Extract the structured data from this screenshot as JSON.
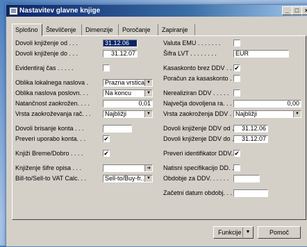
{
  "window": {
    "title": "Nastavitev glavne knjige",
    "minimize": "_",
    "restore": "□",
    "close": "×"
  },
  "tabs": [
    "Splošno",
    "Številčenje",
    "Dimenzije",
    "Poročanje",
    "Zapiranje"
  ],
  "left": {
    "allow_from_label": "Dovoli knjiženje od . . .",
    "allow_from_value": "31.12.06",
    "allow_to_label": "Dovoli knjiženje do . . .",
    "allow_to_value": "31.12.07",
    "register_time_label": "Evidentiraj čas . . . . .",
    "local_address_label": "Oblika lokalnega naslova .",
    "local_address_value": "Prazna vrstica...",
    "business_address_label": "Oblika naslova poslovn. . .",
    "business_address_value": "Na koncu",
    "rounding_precision_label": "Natančnost zaokrožen. . . .",
    "rounding_precision_value": "0,01",
    "rounding_type_label": "Vrsta zaokroževanja rač. . .",
    "rounding_type_value": "Najbližji",
    "allow_delete_label": "Dovoli brisanje konta . . .",
    "check_account_label": "Preveri uporabo konta. . .",
    "post_debit_credit_label": "Knjiži Breme/Dobro . . . .",
    "posting_code_label": "Knjiženje šifre opisa . . .",
    "billto_label": "Bill-to/Sell-to VAT Calc. . .",
    "billto_value": "Sell-to/Buy-fr..."
  },
  "right": {
    "emu_currency_label": "Valuta EMU . . . . . . .",
    "lcy_code_label": "Šifra LVT . . . . . . . .",
    "lcy_code_value": "EUR",
    "cash_discount_label": "Kasaskonto brez DDV . . .",
    "cash_discount_checked": "✔",
    "cash_discount_calc_label": "Poračun za kasaskonto . . .",
    "unrealized_vat_label": "Nerealiziran DDV . . . . .",
    "max_allowed_label": "Največja dovoljena ra. . . .",
    "max_allowed_value": "0,00",
    "vat_rounding_label": "Vrsta zaokroženja DDV . . .",
    "vat_rounding_value": "Najbližji",
    "vat_from_label": "Dovoli knjiženje DDV od . .",
    "vat_from_value": "31.12.06",
    "vat_to_label": "Dovoli knjiženje DDV do . .",
    "vat_to_value": "31.12.07",
    "check_vat_id_label": "Preveri identifikator DDV.",
    "print_vat_spec_label": "Natisni specifikacijo DD. . .",
    "vat_period_label": "Obdobje za DDV. . . . . .",
    "period_start_label": "Začetni datum obdobj. . . ."
  },
  "buttons": {
    "functions": "Funkcije",
    "help": "Pomoč"
  },
  "checkmark": "✔"
}
